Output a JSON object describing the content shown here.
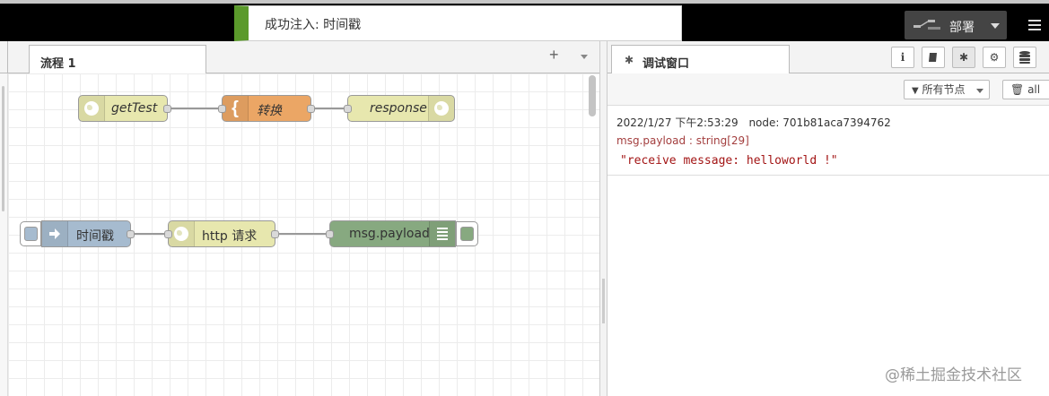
{
  "notification": {
    "text": "成功注入: 时间戳"
  },
  "header": {
    "deploy_label": "部署"
  },
  "workspace": {
    "tab_label": "流程 1",
    "add_tab": "+"
  },
  "flows": {
    "row1": {
      "http_in": "getTest",
      "template": "转换",
      "http_response": "response"
    },
    "row2": {
      "inject": "时间戳",
      "http_request": "http 请求",
      "debug": "msg.payload"
    }
  },
  "sidebar": {
    "tab_label": "调试窗口",
    "filter_label": "所有节点",
    "clear_label": "all",
    "message": {
      "timestamp": "2022/1/27 下午2:53:29",
      "node": "node: 701b81aca7394762",
      "property": "msg.payload : string[29]",
      "value": "\"receive message: helloworld !\""
    }
  },
  "watermark": "@稀土掘金技术社区",
  "icons": {
    "deploy": "deploy-icon",
    "menu": "hamburger-menu-icon",
    "info": "info-icon",
    "book": "book-icon",
    "debug": "bug-icon",
    "config": "gear-icon",
    "context": "database-icon",
    "filter": "filter-icon",
    "trash": "trash-icon"
  },
  "colors": {
    "success": "#5b9a2b",
    "http_node": "#e7e7ae",
    "template_node": "#eba665",
    "inject_node": "#a6bbcf",
    "debug_node": "#87a980"
  }
}
